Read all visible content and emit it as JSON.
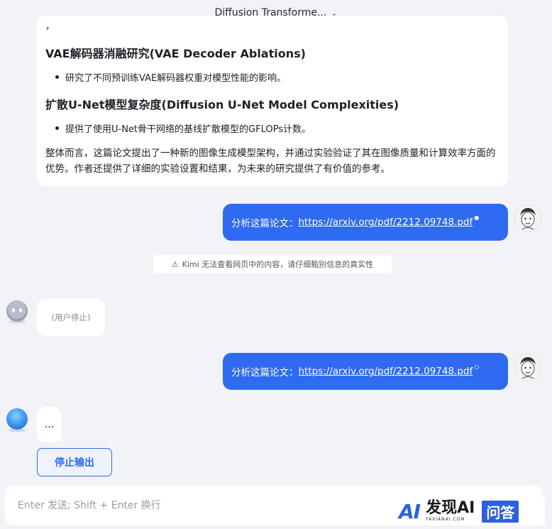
{
  "topbar": {
    "title": "Diffusion Transforme...",
    "chevron_icon": "chevron-down-icon"
  },
  "assistant_message": {
    "truncated_line": "，",
    "sections": [
      {
        "heading": "VAE解码器消融研究(VAE Decoder Ablations)",
        "bullet": "研究了不同预训练VAE解码器权重对模型性能的影响。"
      },
      {
        "heading": "扩散U-Net模型复杂度(Diffusion U-Net Model Complexities)",
        "bullet": "提供了使用U-Net骨干网络的基线扩散模型的GFLOPs计数。"
      }
    ],
    "summary": "整体而言，这篇论文提出了一种新的图像生成模型架构，并通过实验验证了其在图像质量和计算效率方面的优势。作者还提供了详细的实验设置和结果，为未来的研究提供了有价值的参考。"
  },
  "user_messages": [
    {
      "prefix": "分析这篇论文：",
      "link": "https://arxiv.org/pdf/2212.09748.pdf",
      "mark": "●"
    },
    {
      "prefix": "分析这篇论文：",
      "link": "https://arxiv.org/pdf/2212.09748.pdf",
      "mark": "○"
    }
  ],
  "notice": {
    "icon": "warning-icon",
    "text": "Kimi 无法查看网页中的内容，请仔细甄别信息的真实性"
  },
  "bot_replies": {
    "stopped": "(用户停止)",
    "thinking": "..."
  },
  "stop_button": {
    "label": "停止输出"
  },
  "input": {
    "placeholder": "Enter 发送; Shift + Enter 换行"
  },
  "watermark": {
    "ai": "AI",
    "cn": "发现AI",
    "domain": "FAXIANAI.COM",
    "tag": "问答"
  },
  "colors": {
    "accent": "#2f6bf0",
    "background": "#f2f3f7",
    "card": "#ffffff"
  }
}
